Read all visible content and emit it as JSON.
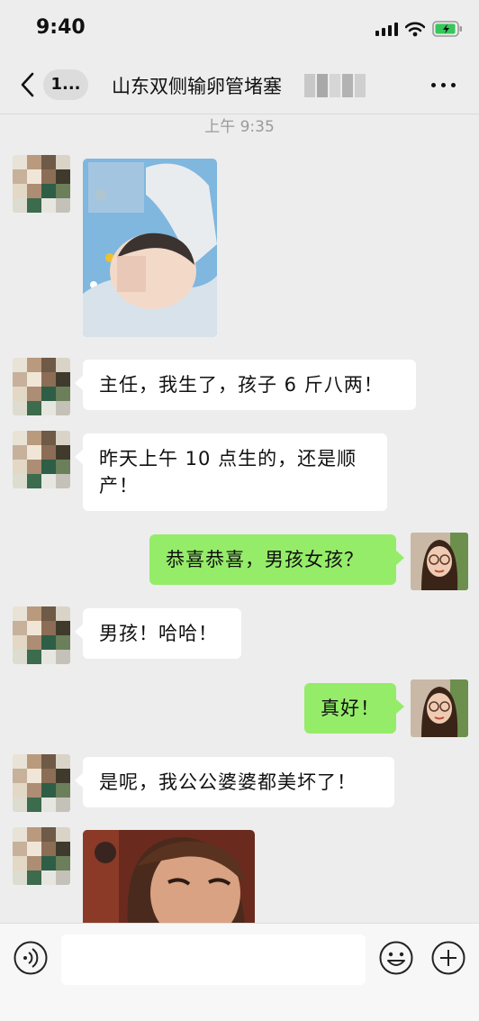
{
  "status_bar": {
    "time": "9:40"
  },
  "nav": {
    "unread_count": "1...",
    "title": "山东双侧输卵管堵塞"
  },
  "chat": {
    "timestamp": "上午 9:35",
    "messages": [
      {
        "type": "image",
        "from": "contact",
        "description": "baby-photo"
      },
      {
        "type": "text",
        "from": "contact",
        "text": "主任，我生了，孩子 6 斤八两！"
      },
      {
        "type": "text",
        "from": "contact",
        "text": "昨天上午 10 点生的，还是顺产！"
      },
      {
        "type": "text",
        "from": "me",
        "text": "恭喜恭喜，男孩女孩？"
      },
      {
        "type": "text",
        "from": "contact",
        "text": "男孩！哈哈！"
      },
      {
        "type": "text",
        "from": "me",
        "text": "真好！"
      },
      {
        "type": "text",
        "from": "contact",
        "text": "是呢，我公公婆婆都美坏了！"
      },
      {
        "type": "image",
        "from": "contact",
        "description": "smiling-woman-photo"
      }
    ]
  },
  "input_bar": {
    "placeholder": ""
  },
  "colors": {
    "background": "#ededed",
    "bubble_in": "#ffffff",
    "bubble_out": "#95ec69"
  }
}
